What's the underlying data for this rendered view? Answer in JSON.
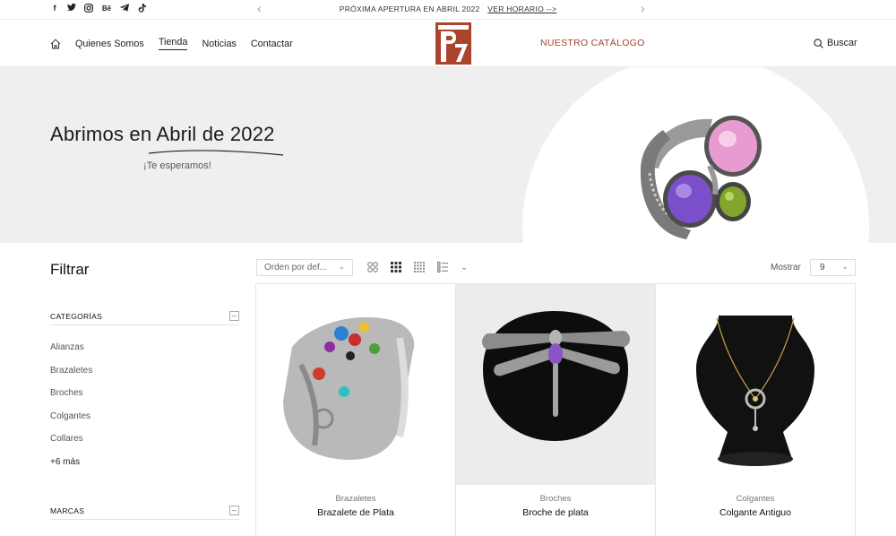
{
  "topbar": {
    "social_icons": [
      "facebook-icon",
      "twitter-icon",
      "instagram-icon",
      "behance-icon",
      "telegram-icon",
      "tiktok-icon"
    ],
    "promo_text": "PRÓXIMA APERTURA EN ABRIL 2022",
    "promo_link": "VER HORARIO -->"
  },
  "nav": {
    "items": [
      "Quienes Somos",
      "Tienda",
      "Noticias",
      "Contactar"
    ],
    "catalog": "NUESTRO CATÁLOGO",
    "search": "Buscar"
  },
  "hero": {
    "title": "Abrimos en Abril de 2022",
    "subtitle": "¡Te esperamos!"
  },
  "filter": {
    "title": "Filtrar",
    "categories_heading": "CATEGORÍAS",
    "categories": [
      "Alianzas",
      "Brazaletes",
      "Broches",
      "Colgantes",
      "Collares"
    ],
    "more": "+6 más",
    "brands_heading": "MARCAS"
  },
  "toolbar": {
    "sort": "Orden por def...",
    "show_label": "Mostrar",
    "per_page": "9"
  },
  "products": [
    {
      "category": "Brazaletes",
      "name": "Brazalete de Plata"
    },
    {
      "category": "Broches",
      "name": "Broche de plata"
    },
    {
      "category": "Colgantes",
      "name": "Colgante Antiguo"
    }
  ],
  "colors": {
    "accent": "#a0452c",
    "hero_bg": "#efefef"
  }
}
